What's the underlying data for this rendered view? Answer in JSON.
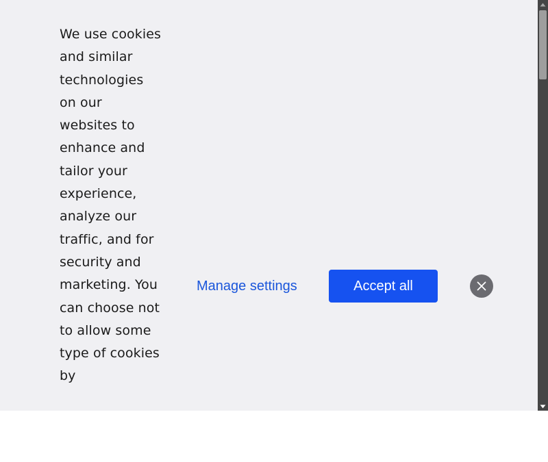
{
  "cookie_banner": {
    "message": "We use cookies and similar technologies on our websites to enhance and tailor your experience, analyze our traffic, and for security and marketing. You can choose not to allow some type of cookies by",
    "manage_settings_label": "Manage settings",
    "accept_all_label": "Accept all",
    "close_icon": "close-icon"
  },
  "colors": {
    "banner_background": "#f0f0f3",
    "link_blue": "#1a56db",
    "primary_button": "#1652f0",
    "close_button": "#6b6b70",
    "scrollbar_track": "#454545",
    "scrollbar_thumb": "#9e9e9e"
  },
  "scrollbar": {
    "up_icon": "scroll-up-arrow-icon",
    "down_icon": "scroll-down-arrow-icon"
  }
}
